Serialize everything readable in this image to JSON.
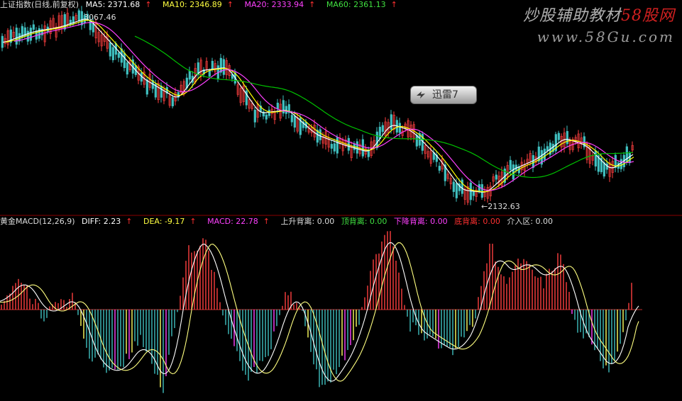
{
  "header": {
    "index_name": "上证指数(日线,前复权)",
    "ma5": "MA5: 2371.68",
    "ma10": "MA10: 2346.89",
    "ma20": "MA20: 2333.94",
    "ma60": "MA60: 2361.13",
    "arrow": "↑"
  },
  "price_labels": {
    "high": "3067.46",
    "low": "←2132.63"
  },
  "macd_header": {
    "name": "黄金MACD(12,26,9)",
    "diff": "DIFF: 2.23",
    "dea": "DEA: -9.17",
    "macd": "MACD: 22.78",
    "up_div_label": "上升背离: 0.00",
    "top_div_label": "顶背离: 0.00",
    "down_div_label": "下降背离: 0.00",
    "bottom_div_label": "底背离: 0.00",
    "entry_label": "介入区: 0.00"
  },
  "watermark": {
    "title_gray": "炒股辅助教材",
    "title_red": "58股网",
    "url": "www.58Gu.com"
  },
  "overlay_button": {
    "label": "迅雷7"
  },
  "colors": {
    "ma5": "#ffffff",
    "ma10": "#ffff00",
    "ma20": "#ff40ff",
    "ma60": "#00c000",
    "up": "#ff4040",
    "down": "#40c0c0",
    "divider": "#8b0000"
  }
}
